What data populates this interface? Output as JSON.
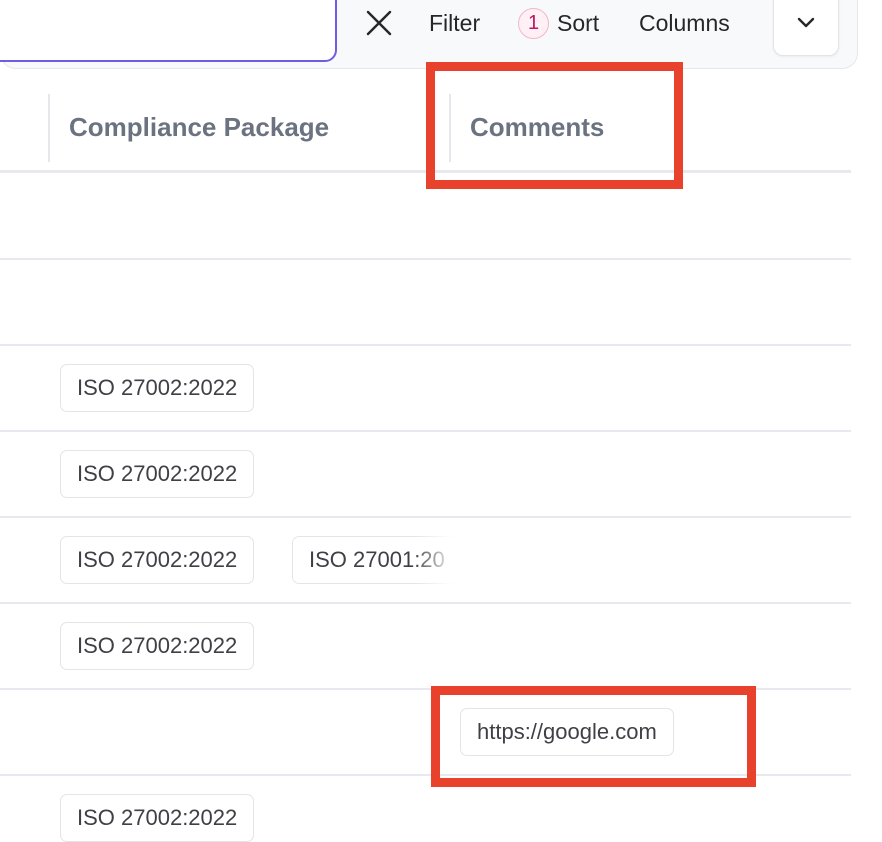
{
  "toolbar": {
    "filter_label": "Filter",
    "sort_count": "1",
    "sort_label": "Sort",
    "columns_label": "Columns",
    "icons": {
      "clear": "close-icon",
      "dropdown": "chevron-down-icon"
    }
  },
  "table": {
    "headers": [
      "Compliance Package",
      "Comments"
    ],
    "rows": [
      {
        "packages": [],
        "comment": ""
      },
      {
        "packages": [],
        "comment": ""
      },
      {
        "packages": [
          "ISO 27002:2022"
        ],
        "comment": ""
      },
      {
        "packages": [
          "ISO 27002:2022"
        ],
        "comment": ""
      },
      {
        "packages": [
          "ISO 27002:2022",
          "ISO 27001:20"
        ],
        "comment": ""
      },
      {
        "packages": [
          "ISO 27002:2022"
        ],
        "comment": ""
      },
      {
        "packages": [],
        "comment": "https://google.com"
      },
      {
        "packages": [
          "ISO 27002:2022"
        ],
        "comment": ""
      }
    ]
  },
  "colors": {
    "search_focus": "#6d5ee0",
    "highlight": "#e8412c",
    "badge": "#be185d"
  }
}
